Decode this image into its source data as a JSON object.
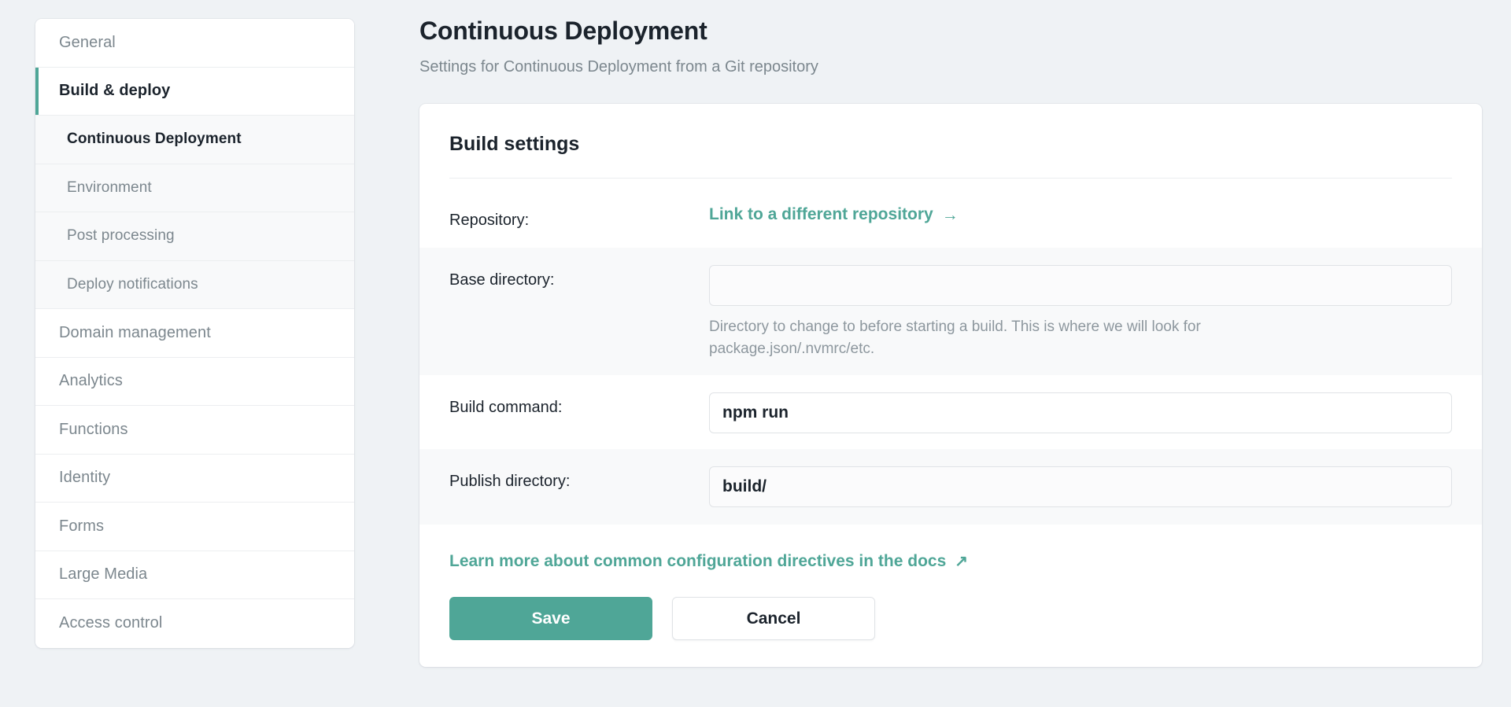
{
  "sidebar": {
    "items": [
      {
        "label": "General",
        "level": "top",
        "state": "default"
      },
      {
        "label": "Build & deploy",
        "level": "top",
        "state": "active"
      },
      {
        "label": "Continuous Deployment",
        "level": "sub",
        "state": "current"
      },
      {
        "label": "Environment",
        "level": "sub",
        "state": "default"
      },
      {
        "label": "Post processing",
        "level": "sub",
        "state": "default"
      },
      {
        "label": "Deploy notifications",
        "level": "sub",
        "state": "default"
      },
      {
        "label": "Domain management",
        "level": "top",
        "state": "default"
      },
      {
        "label": "Analytics",
        "level": "top",
        "state": "default"
      },
      {
        "label": "Functions",
        "level": "top",
        "state": "default"
      },
      {
        "label": "Identity",
        "level": "top",
        "state": "default"
      },
      {
        "label": "Forms",
        "level": "top",
        "state": "default"
      },
      {
        "label": "Large Media",
        "level": "top",
        "state": "default"
      },
      {
        "label": "Access control",
        "level": "top",
        "state": "default"
      }
    ]
  },
  "header": {
    "title": "Continuous Deployment",
    "subtitle": "Settings for Continuous Deployment from a Git repository"
  },
  "card": {
    "title": "Build settings",
    "rows": {
      "repository": {
        "label": "Repository:",
        "link_label": "Link to a different repository",
        "link_icon": "arrow-right-icon",
        "link_glyph": "→"
      },
      "base_directory": {
        "label": "Base directory:",
        "value": "",
        "placeholder": "",
        "helper": "Directory to change to before starting a build. This is where we will look for package.json/.nvmrc/etc."
      },
      "build_command": {
        "label": "Build command:",
        "value": "npm run",
        "placeholder": ""
      },
      "publish_directory": {
        "label": "Publish directory:",
        "value": "build/",
        "placeholder": ""
      }
    },
    "docs_link": {
      "label": "Learn more about common configuration directives in the docs",
      "icon": "external-link-icon",
      "glyph": "↗"
    },
    "actions": {
      "save_label": "Save",
      "cancel_label": "Cancel"
    }
  },
  "colors": {
    "accent_teal": "#4fa697",
    "page_background": "#eff2f5",
    "text_dark": "#1b232c",
    "text_muted": "#7c878e",
    "row_shaded": "#f8f9fa"
  }
}
